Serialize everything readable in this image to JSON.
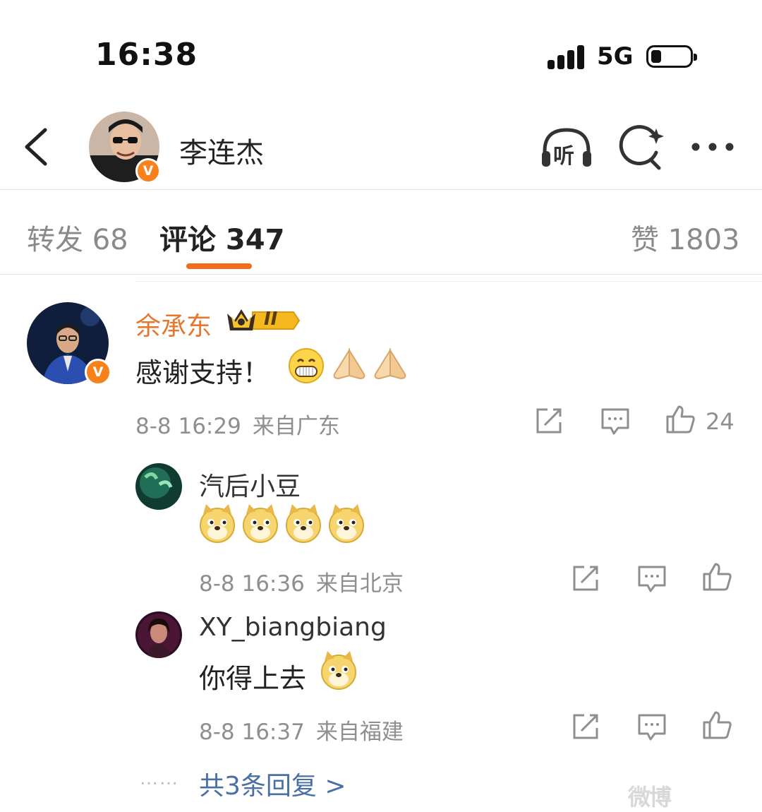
{
  "status_bar": {
    "time": "16:38",
    "network": "5G"
  },
  "header": {
    "name": "李连杰",
    "verified_badge": "V",
    "listen_label": "听"
  },
  "tabs": [
    {
      "label": "转发 68"
    },
    {
      "label": "评论 347",
      "active": true
    },
    {
      "label": "赞 1803"
    }
  ],
  "comment": {
    "user": "余承东",
    "member_badge": "II",
    "verified_badge": "V",
    "text": "感谢支持！",
    "emojis": [
      "grin-emoji",
      "pray-emoji",
      "pray-emoji"
    ],
    "date": "8-8 16:29",
    "location": "来自广东",
    "likes": "24"
  },
  "replies": [
    {
      "user": "汽后小豆",
      "text": "",
      "emojis": [
        "doge-emoji",
        "doge-emoji",
        "doge-emoji",
        "doge-emoji"
      ],
      "date": "8-8 16:36",
      "location": "来自北京"
    },
    {
      "user": "XY_biangbiang",
      "text": "你得上去",
      "emojis": [
        "doge-emoji"
      ],
      "date": "8-8 16:37",
      "location": "来自福建"
    }
  ],
  "more_replies": {
    "dots": "……",
    "label": "共3条回复 >"
  },
  "watermark": "微博",
  "colors": {
    "accent": "#f26d1a",
    "vip_name": "#e8772e",
    "link": "#4a6fa5",
    "meta": "#8f8f8f"
  }
}
